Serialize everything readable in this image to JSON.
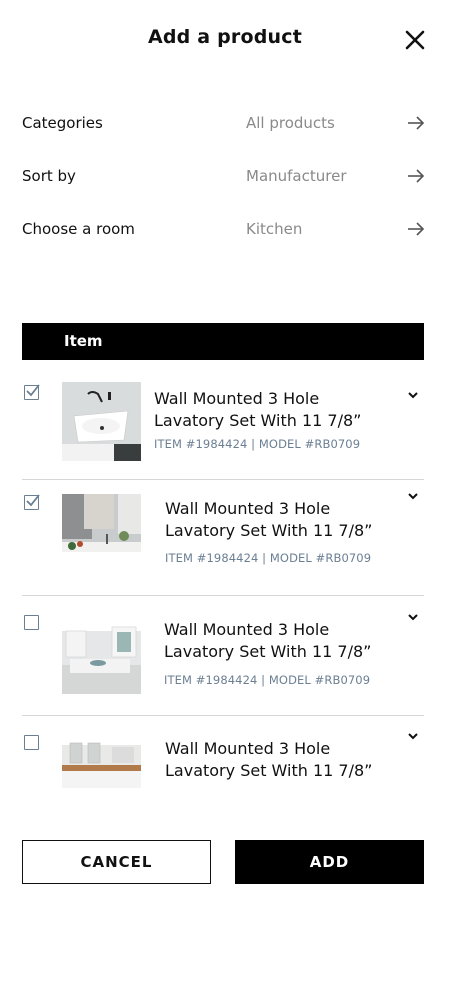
{
  "header": {
    "title": "Add a product"
  },
  "filters": [
    {
      "label": "Categories",
      "value": "All products"
    },
    {
      "label": "Sort by",
      "value": "Manufacturer"
    },
    {
      "label": "Choose a room",
      "value": "Kitchen"
    }
  ],
  "table": {
    "header_label": "Item"
  },
  "items": [
    {
      "checked": true,
      "name_line1": "Wall Mounted 3 Hole",
      "name_line2": "Lavatory Set With 11 7/8”",
      "meta": "ITEM #1984424 | MODEL #RB0709"
    },
    {
      "checked": true,
      "name_line1": "Wall Mounted 3 Hole",
      "name_line2": "Lavatory Set With 11 7/8”",
      "meta": "ITEM #1984424 | MODEL #RB0709"
    },
    {
      "checked": false,
      "name_line1": "Wall Mounted 3 Hole",
      "name_line2": "Lavatory Set With 11 7/8”",
      "meta": "ITEM #1984424 | MODEL #RB0709"
    },
    {
      "checked": false,
      "name_line1": "Wall Mounted 3 Hole",
      "name_line2": "Lavatory Set With 11 7/8”",
      "meta": ""
    }
  ],
  "actions": {
    "cancel_label": "CANCEL",
    "add_label": "ADD"
  },
  "colors": {
    "accent": "#000000",
    "muted_text": "#8a8a8a",
    "meta_text": "#6b7f93",
    "divider": "#d6d6d6"
  }
}
